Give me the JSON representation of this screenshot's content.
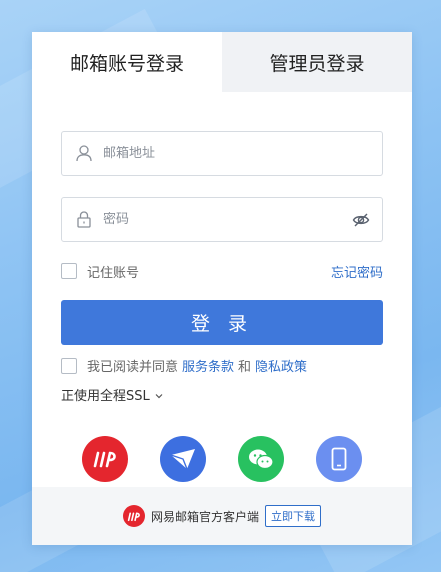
{
  "tabs": [
    {
      "label": "邮箱账号登录",
      "active": true
    },
    {
      "label": "管理员登录",
      "active": false
    }
  ],
  "form": {
    "email_placeholder": "邮箱地址",
    "password_placeholder": "密码",
    "remember_label": "记住账号",
    "forgot_label": "忘记密码",
    "login_label": "登 录"
  },
  "agree": {
    "prefix": "我已阅读并同意",
    "terms": "服务条款",
    "and": "和",
    "privacy": "隐私政策"
  },
  "ssl": {
    "label": "正使用全程SSL"
  },
  "apps": [
    {
      "icon": "netease-mail-icon",
      "color": "#e4262e"
    },
    {
      "icon": "paper-plane-icon",
      "color": "#3d6fe0"
    },
    {
      "icon": "wechat-icon",
      "color": "#28c160"
    },
    {
      "icon": "mobile-phone-icon",
      "color": "#6b8ff0"
    }
  ],
  "footer": {
    "text": "网易邮箱官方客户端",
    "download_label": "立即下载"
  },
  "colors": {
    "primary": "#3f78db",
    "link": "#2f6ec9",
    "brand_red": "#e4262e"
  }
}
